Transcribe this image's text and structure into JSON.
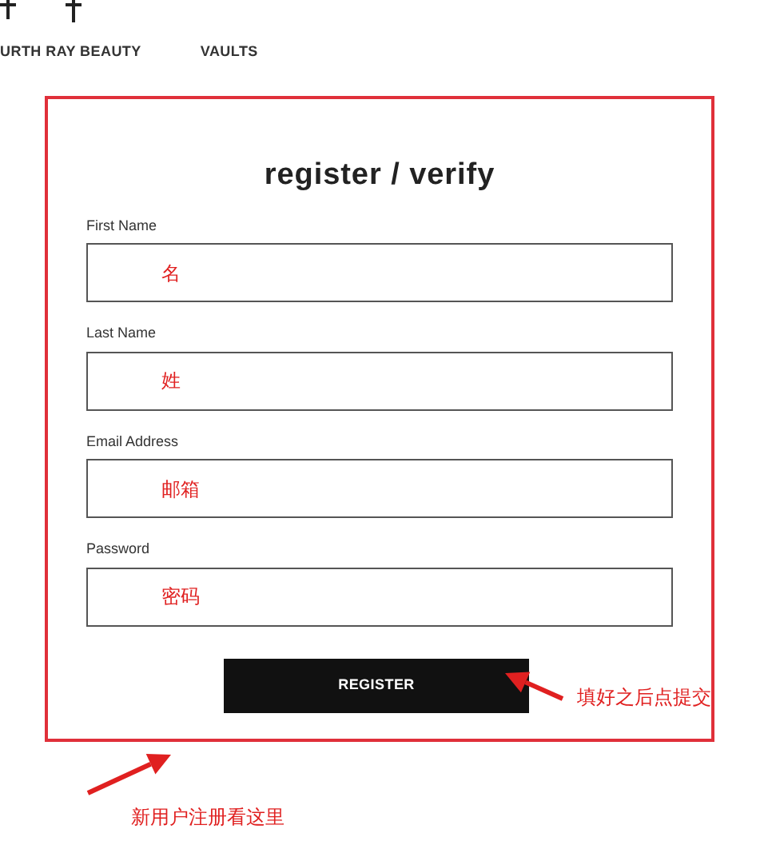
{
  "nav": {
    "items": [
      "URTH RAY BEAUTY",
      "VAULTS"
    ]
  },
  "form": {
    "title": "register / verify",
    "fields": [
      {
        "label": "First Name",
        "note": "名"
      },
      {
        "label": "Last Name",
        "note": "姓"
      },
      {
        "label": "Email Address",
        "note": "邮箱"
      },
      {
        "label": "Password",
        "note": "密码"
      }
    ],
    "button": "REGISTER"
  },
  "annotations": [
    {
      "kind": "button-hint",
      "text": "填好之后点提交"
    },
    {
      "kind": "box-hint",
      "text": "新用户注册看这里"
    }
  ]
}
